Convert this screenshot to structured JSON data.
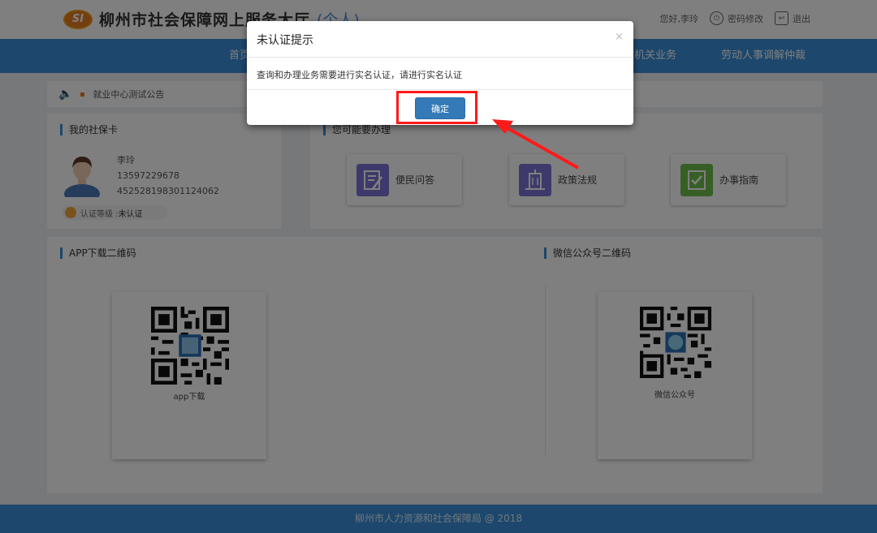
{
  "header": {
    "logo_mark": "SI",
    "site_title": "柳州市社会保障网上服务大厅",
    "site_suffix": "(个人)",
    "greeting": "您好,李玲",
    "change_password": "密码修改",
    "logout": "退出"
  },
  "nav": {
    "items": [
      "首页",
      "局机关业务",
      "劳动人事调解仲裁"
    ]
  },
  "notice": {
    "text": "就业中心测试公告"
  },
  "social_card": {
    "title": "我的社保卡",
    "name": "李玲",
    "phone": "13597229678",
    "id_number": "452528198301124062",
    "cert_label": "认证等级 : ",
    "cert_value": "未认证"
  },
  "services": {
    "title": "您可能要办理",
    "items": [
      {
        "label": "便民问答",
        "icon": "qa-icon",
        "color": "#7b74d6"
      },
      {
        "label": "政策法规",
        "icon": "building-icon",
        "color": "#7b74d6"
      },
      {
        "label": "办事指南",
        "icon": "guide-icon",
        "color": "#6fbf4a"
      }
    ]
  },
  "qr_section": {
    "app_title": "APP下载二维码",
    "app_label": "app下载",
    "wechat_title": "微信公众号二维码",
    "wechat_label": "微信公众号"
  },
  "footer": {
    "text": "柳州市人力资源和社会保障局 @ 2018"
  },
  "modal": {
    "title": "未认证提示",
    "close": "×",
    "message": "查询和办理业务需要进行实名认证，请进行实名认证",
    "ok_label": "确定"
  },
  "colors": {
    "primary": "#3a8fd8",
    "button": "#337ab7",
    "highlight": "#ff1a1a"
  }
}
